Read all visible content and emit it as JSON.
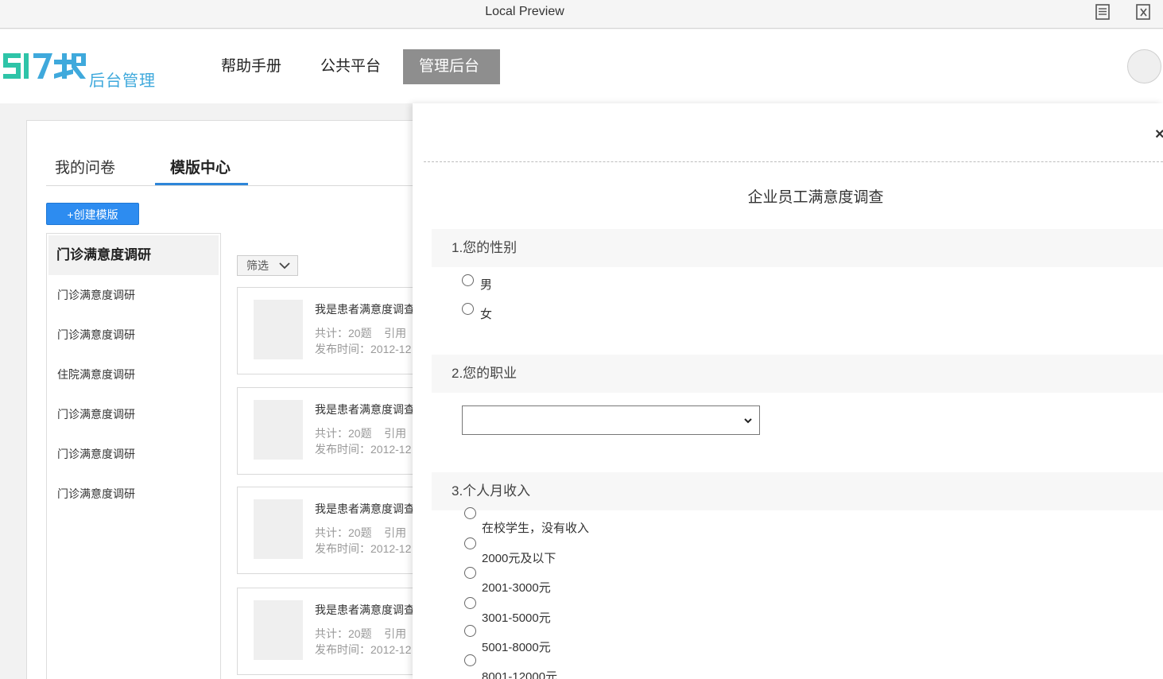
{
  "window": {
    "title": "Local Preview"
  },
  "brand": {
    "logo_text": "ЭI7护",
    "subtitle": "后台管理"
  },
  "nav": {
    "items": [
      {
        "label": "帮助手册"
      },
      {
        "label": "公共平台"
      },
      {
        "label": "管理后台",
        "active": true
      }
    ]
  },
  "tabs": [
    {
      "label": "我的问卷"
    },
    {
      "label": "模版中心",
      "active": true
    }
  ],
  "create_button": "+创建模版",
  "sidebar": {
    "header": "门诊满意度调研",
    "items": [
      "门诊满意度调研",
      "门诊满意度调研",
      "住院满意度调研",
      "门诊满意度调研",
      "门诊满意度调研",
      "门诊满意度调研"
    ]
  },
  "filter_label": "筛选",
  "templates": [
    {
      "name": "我是患者满意度调查",
      "count": "共计：20题",
      "ref": "引用",
      "date": "发布时间：2012-12"
    },
    {
      "name": "我是患者满意度调查",
      "count": "共计：20题",
      "ref": "引用",
      "date": "发布时间：2012-12"
    },
    {
      "name": "我是患者满意度调查",
      "count": "共计：20题",
      "ref": "引用",
      "date": "发布时间：2012-12"
    },
    {
      "name": "我是患者满意度调查",
      "count": "共计：20题",
      "ref": "引用",
      "date": "发布时间：2012-12"
    }
  ],
  "preview": {
    "close": "×",
    "title": "企业员工满意度调查",
    "q1": {
      "title": "1.您的性别",
      "options": [
        "男",
        "女"
      ]
    },
    "q2": {
      "title": "2.您的职业",
      "selected": ""
    },
    "q3": {
      "title": "3.个人月收入",
      "options": [
        "在校学生，没有收入",
        "2000元及以下",
        "2001-3000元",
        "3001-5000元",
        "5001-8000元",
        "8001-12000元"
      ]
    }
  },
  "colors": {
    "accent": "#2d8cf0",
    "nav_active": "#8e8e8e",
    "logo": "#3fa9dc"
  }
}
